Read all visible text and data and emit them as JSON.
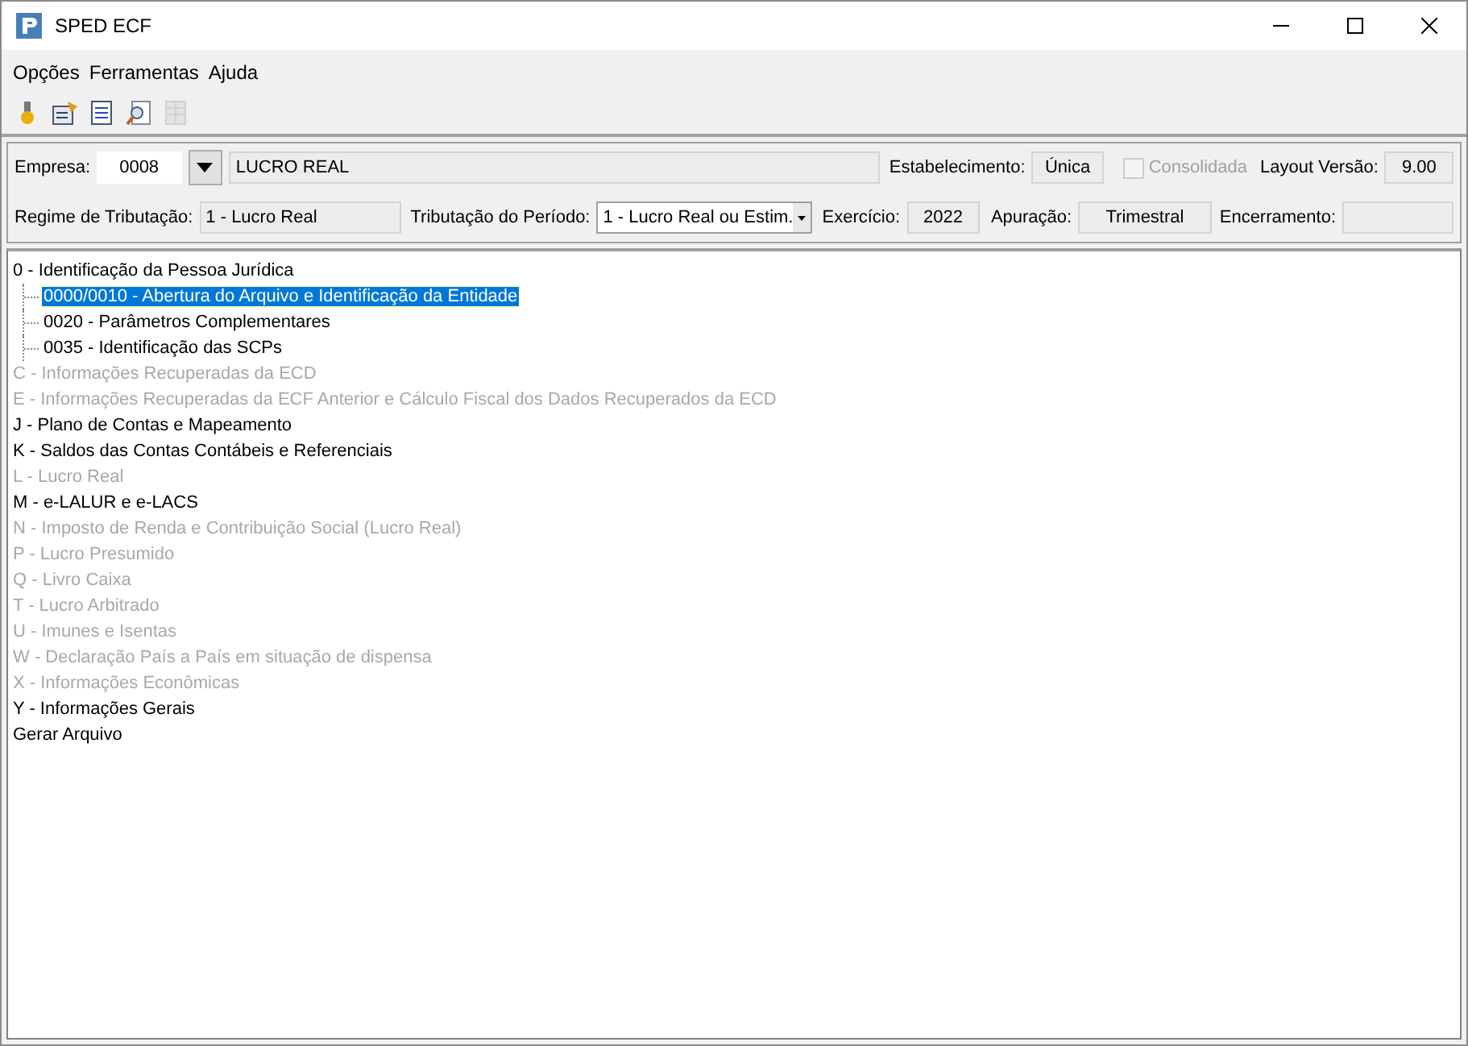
{
  "window": {
    "title": "SPED ECF"
  },
  "menu": [
    "Opções",
    "Ferramentas",
    "Ajuda"
  ],
  "toolbar": [
    {
      "kind": "wizard",
      "disabled": false
    },
    {
      "kind": "properties",
      "disabled": false
    },
    {
      "kind": "document",
      "disabled": false
    },
    {
      "kind": "preview",
      "disabled": false
    },
    {
      "kind": "grid",
      "disabled": true
    }
  ],
  "header": {
    "empresa_label": "Empresa:",
    "empresa_code": "0008",
    "empresa_name": "LUCRO REAL",
    "estabelecimento_label": "Estabelecimento:",
    "estabelecimento": "Única",
    "consolidada": {
      "label": "Consolidada",
      "checked": false,
      "disabled": true
    },
    "layout_label": "Layout Versão:",
    "layout": "9.00",
    "regime_label": "Regime de Tributação:",
    "regime": "1 - Lucro Real",
    "periodo_label": "Tributação do Período:",
    "periodo": "1 - Lucro Real ou Estim.",
    "exercicio_label": "Exercício:",
    "exercicio": "2022",
    "apuracao_label": "Apuração:",
    "apuracao": "Trimestral",
    "encerramento_label": "Encerramento:"
  },
  "tree": [
    {
      "label": "0 - Identificação da Pessoa Jurídica",
      "disabled": false,
      "selected": false,
      "children": [
        {
          "label": "0000/0010 - Abertura do Arquivo e Identificação da Entidade",
          "disabled": false,
          "selected": true
        },
        {
          "label": "0020 - Parâmetros Complementares",
          "disabled": false,
          "selected": false
        },
        {
          "label": "0035 - Identificação das SCPs",
          "disabled": false,
          "selected": false
        }
      ]
    },
    {
      "label": "C - Informações Recuperadas da ECD",
      "disabled": true,
      "selected": false
    },
    {
      "label": "E - Informações Recuperadas da ECF Anterior e Cálculo Fiscal dos Dados Recuperados da ECD",
      "disabled": true,
      "selected": false
    },
    {
      "label": "J - Plano de Contas e Mapeamento",
      "disabled": false,
      "selected": false
    },
    {
      "label": "K - Saldos das Contas Contábeis e Referenciais",
      "disabled": false,
      "selected": false
    },
    {
      "label": "L - Lucro Real",
      "disabled": true,
      "selected": false
    },
    {
      "label": "M - e-LALUR e e-LACS",
      "disabled": false,
      "selected": false
    },
    {
      "label": "N - Imposto de Renda e Contribuição Social (Lucro Real)",
      "disabled": true,
      "selected": false
    },
    {
      "label": "P - Lucro Presumido",
      "disabled": true,
      "selected": false
    },
    {
      "label": "Q - Livro Caixa",
      "disabled": true,
      "selected": false
    },
    {
      "label": "T - Lucro Arbitrado",
      "disabled": true,
      "selected": false
    },
    {
      "label": "U - Imunes e Isentas",
      "disabled": true,
      "selected": false
    },
    {
      "label": "W - Declaração País a País em situação de dispensa",
      "disabled": true,
      "selected": false
    },
    {
      "label": "X - Informações Econômicas",
      "disabled": true,
      "selected": false
    },
    {
      "label": "Y - Informações Gerais",
      "disabled": false,
      "selected": false
    },
    {
      "label": "Gerar Arquivo",
      "disabled": false,
      "selected": false
    }
  ]
}
